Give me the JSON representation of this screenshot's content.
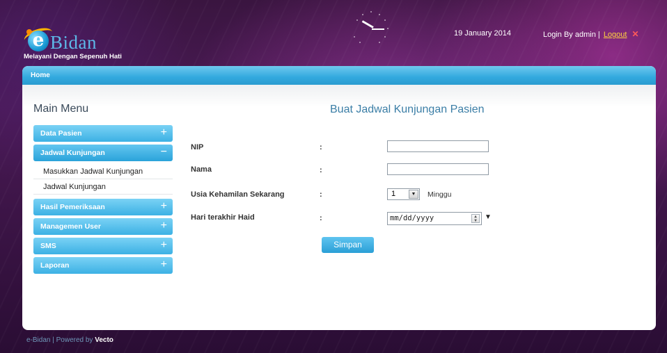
{
  "header": {
    "logo_name": "Bidan",
    "logo_letter": "e",
    "tagline": "Melayani Dengan Sepenuh Hati",
    "date": "19 January 2014",
    "login_prefix": "Login By admin |",
    "logout_label": "Logout"
  },
  "nav": {
    "home": "Home"
  },
  "sidebar": {
    "title": "Main Menu",
    "items": [
      {
        "label": "Data Pasien",
        "sign": "+"
      },
      {
        "label": "Jadwal Kunjungan",
        "sign": "−"
      },
      {
        "label": "Hasil Pemeriksaan",
        "sign": "+"
      },
      {
        "label": "Managemen User",
        "sign": "+"
      },
      {
        "label": "SMS",
        "sign": "+"
      },
      {
        "label": "Laporan",
        "sign": "+"
      }
    ],
    "submenu": [
      "Masukkan Jadwal Kunjungan",
      "Jadwal Kunjungan"
    ]
  },
  "form": {
    "title": "Buat Jadwal Kunjungan Pasien",
    "colon": ":",
    "fields": {
      "nip": {
        "label": "NIP",
        "value": ""
      },
      "nama": {
        "label": "Nama",
        "value": ""
      },
      "usia": {
        "label": "Usia Kehamilan Sekarang",
        "selected": "1",
        "unit": "Minggu"
      },
      "hari": {
        "label": "Hari terakhir Haid",
        "placeholder": "mm/dd/yyyy"
      }
    },
    "submit_label": "Simpan"
  },
  "footer": {
    "text": "e-Bidan | Powered by",
    "brand": "Vecto"
  },
  "colors": {
    "accent": "#3cb1e4",
    "logout": "#ffd23f",
    "title": "#3b7ea6"
  }
}
